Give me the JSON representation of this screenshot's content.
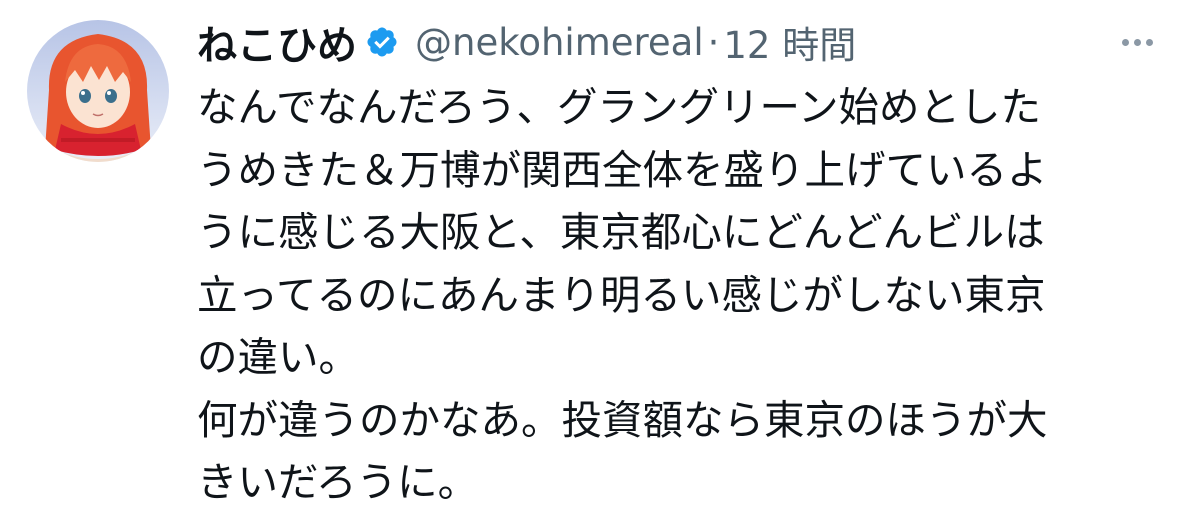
{
  "author": {
    "display_name": "ねこひめ",
    "handle": "@nekohimereal",
    "separator": "·",
    "time_ago": "12 時間",
    "verified": true
  },
  "tweet": {
    "lines": [
      "なんでなんだろう、グラングリーン始めとした",
      "うめきた＆万博が関西全体を盛り上げているよ",
      "うに感じる大阪と、東京都心にどんどんビルは",
      "立ってるのにあんまり明るい感じがしない東京",
      "の違い。",
      "何が違うのかなあ。投資額なら東京のほうが大",
      "きいだろうに。"
    ]
  },
  "icons": {
    "avatar": "avatar-illustration",
    "verified": "verified-badge-icon",
    "more": "more-options-icon"
  },
  "colors": {
    "text": "#0f1419",
    "secondary": "#536471",
    "verified": "#1d9bf0"
  }
}
